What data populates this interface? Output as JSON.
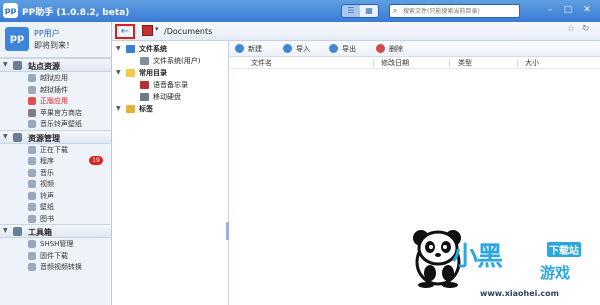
{
  "window": {
    "title": "PP助手 (1.0.8.2, beta)",
    "search_placeholder": "搜索文件(只能搜索当前目录)",
    "view_icons": [
      "list-view-icon",
      "grid-view-icon"
    ],
    "controls": [
      "search-icon",
      "minimize-icon",
      "maximize-icon",
      "close-icon"
    ]
  },
  "user": {
    "name": "PP用户",
    "subtitle": "即将到来！"
  },
  "sidebar": {
    "sections": [
      {
        "title": "站点资源",
        "items": [
          {
            "label": "越狱应用"
          },
          {
            "label": "越狱插件"
          },
          {
            "label": "正版应用",
            "active": true
          },
          {
            "label": "苹果官方商店"
          },
          {
            "label": "音乐铃声壁纸"
          }
        ]
      },
      {
        "title": "资源管理",
        "items": [
          {
            "label": "正在下载"
          },
          {
            "label": "程序",
            "badge": "19"
          },
          {
            "label": "音乐"
          },
          {
            "label": "视频"
          },
          {
            "label": "铃声"
          },
          {
            "label": "壁纸"
          },
          {
            "label": "图书"
          }
        ]
      },
      {
        "title": "工具箱",
        "items": [
          {
            "label": "SHSH管理"
          },
          {
            "label": "固件下载"
          },
          {
            "label": "音频视频转换"
          }
        ]
      }
    ]
  },
  "addressbar": {
    "path": "/Documents",
    "back_icon": "back-arrow-icon"
  },
  "tree": {
    "items": [
      {
        "label": "文件系统",
        "bold": true
      },
      {
        "label": "文件系统(用户)",
        "bold": false
      },
      {
        "label": "常用目录",
        "bold": true
      },
      {
        "label": "语音备忘录",
        "bold": false
      },
      {
        "label": "移动硬盘",
        "bold": false
      },
      {
        "label": "标签",
        "bold": true
      }
    ]
  },
  "actions": {
    "new": "新建",
    "import": "导入",
    "export": "导出",
    "delete": "删除"
  },
  "table": {
    "columns": [
      "文件名",
      "修改日期",
      "类型",
      "大小"
    ]
  },
  "watermark": {
    "brand": "小黑",
    "site": "下载站",
    "game": "游戏",
    "url": "www.xiaohei.com"
  },
  "colors": {
    "titlebar": "#3a7bd5",
    "accent": "#2aa7df",
    "active_text": "#e02020",
    "badge": "#e02020",
    "highlight_border": "#d61f1f"
  }
}
